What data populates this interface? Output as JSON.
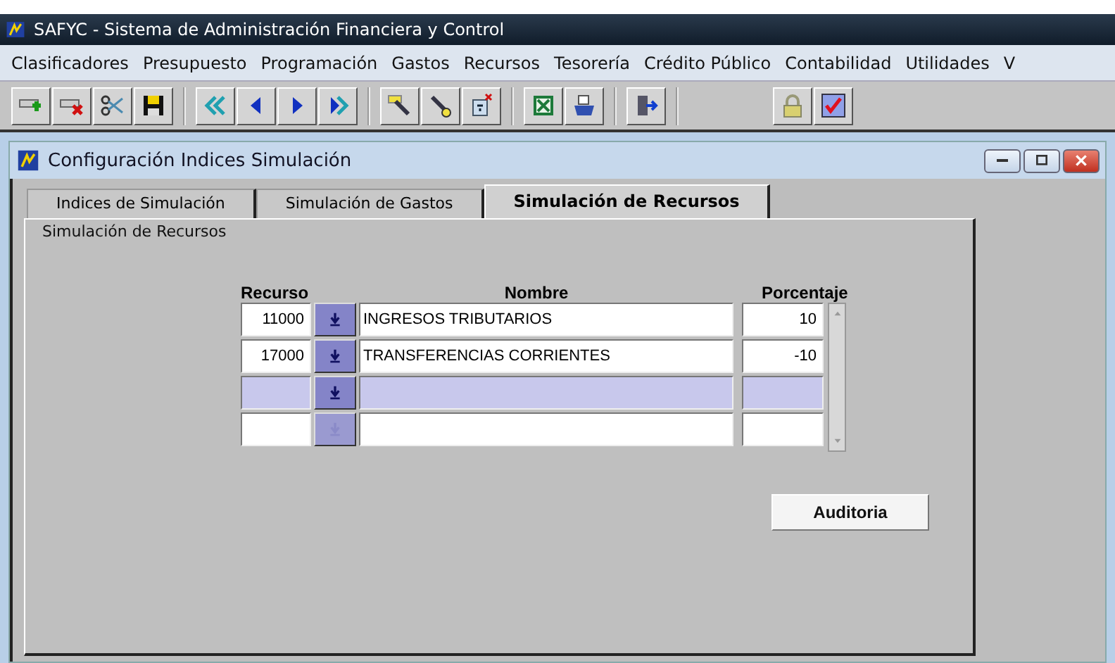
{
  "app_window": {
    "title": "SAFYC - Sistema de Administración Financiera y Control"
  },
  "menu": [
    "Clasificadores",
    "Presupuesto",
    "Programación",
    "Gastos",
    "Recursos",
    "Tesorería",
    "Crédito Público",
    "Contabilidad",
    "Utilidades",
    "V"
  ],
  "child_window": {
    "title": "Configuración Indices Simulación",
    "tabs": [
      {
        "label": "Indices de Simulación",
        "selected": false
      },
      {
        "label": "Simulación de Gastos",
        "selected": false
      },
      {
        "label": "Simulación de Recursos",
        "selected": true
      }
    ],
    "section_label": "Simulación de Recursos",
    "table": {
      "columns": [
        "Recurso",
        "Nombre",
        "Porcentaje"
      ],
      "rows": [
        {
          "recurso": "11000",
          "nombre": "INGRESOS TRIBUTARIOS",
          "porcentaje": "10",
          "selected": false,
          "disabled": false
        },
        {
          "recurso": "17000",
          "nombre": "TRANSFERENCIAS CORRIENTES",
          "porcentaje": "-10",
          "selected": false,
          "disabled": false
        },
        {
          "recurso": "",
          "nombre": "",
          "porcentaje": "",
          "selected": true,
          "disabled": false
        },
        {
          "recurso": "",
          "nombre": "",
          "porcentaje": "",
          "selected": false,
          "disabled": true
        }
      ]
    },
    "audit_button": "Auditoria"
  }
}
